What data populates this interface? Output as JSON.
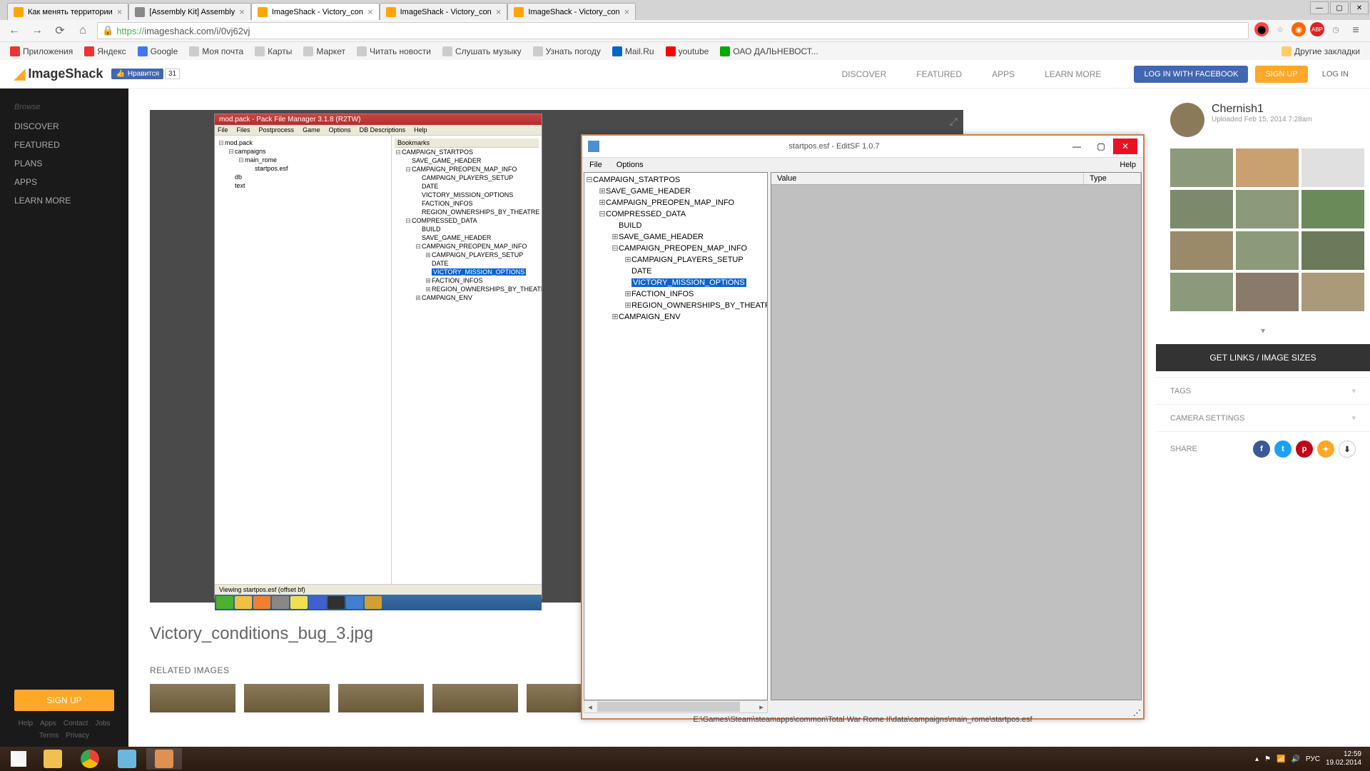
{
  "browser": {
    "tabs": [
      {
        "label": "Как менять территории",
        "active": false
      },
      {
        "label": "[Assembly Kit] Assembly",
        "active": false
      },
      {
        "label": "ImageShack - Victory_con",
        "active": true
      },
      {
        "label": "ImageShack - Victory_con",
        "active": false
      },
      {
        "label": "ImageShack - Victory_con",
        "active": false
      }
    ],
    "url_prefix": "https://",
    "url": "imageshack.com/i/0vj62vj",
    "bookmarks": [
      "Приложения",
      "Яндекс",
      "Google",
      "Моя почта",
      "Карты",
      "Маркет",
      "Читать новости",
      "Слушать музыку",
      "Узнать погоду",
      "Mail.Ru",
      "youtube",
      "ОАО ДАЛЬНЕВОСТ..."
    ],
    "other_bookmarks": "Другие закладки"
  },
  "imageshack": {
    "logo": "ImageShack",
    "fb_like": "Нравится",
    "fb_count": "31",
    "nav": [
      "DISCOVER",
      "FEATURED",
      "APPS",
      "LEARN MORE"
    ],
    "btn_fb": "LOG IN WITH FACEBOOK",
    "btn_signup": "SIGN UP",
    "btn_login": "LOG IN",
    "sidebar": {
      "heading": "Browse",
      "items": [
        "DISCOVER",
        "FEATURED",
        "PLANS",
        "APPS",
        "LEARN MORE"
      ],
      "signup": "SIGN UP",
      "footer": [
        "Help",
        "Apps",
        "Contact",
        "Jobs",
        "Terms",
        "Privacy"
      ]
    },
    "image_title": "Victory_conditions_bug_3.jpg",
    "related_title": "RELATED IMAGES",
    "right": {
      "user": "Chernish1",
      "uploaded": "Uploaded Feb 15, 2014 7:28am",
      "links_btn": "GET LINKS / IMAGE SIZES",
      "tags": "TAGS",
      "camera": "CAMERA SETTINGS",
      "share": "SHARE"
    }
  },
  "pfm": {
    "title": "mod.pack - Pack File Manager 3.1.8 (R2TW)",
    "menu": [
      "File",
      "Files",
      "Postprocess",
      "Game",
      "Options",
      "DB Descriptions",
      "Help"
    ],
    "bookmarks_label": "Bookmarks",
    "status": "Viewing startpos.esf (offset bf)",
    "left_tree": {
      "root": "mod.pack",
      "children": [
        {
          "l": "campaigns",
          "c": [
            {
              "l": "main_rome",
              "c": [
                {
                  "l": "startpos.esf"
                }
              ]
            }
          ]
        },
        {
          "l": "db"
        },
        {
          "l": "text"
        }
      ]
    },
    "right_tree": [
      {
        "l": "CAMPAIGN_STARTPOS",
        "e": "-",
        "c": [
          {
            "l": "SAVE_GAME_HEADER"
          },
          {
            "l": "CAMPAIGN_PREOPEN_MAP_INFO",
            "e": "-",
            "c": [
              {
                "l": "CAMPAIGN_PLAYERS_SETUP"
              },
              {
                "l": "DATE"
              },
              {
                "l": "VICTORY_MISSION_OPTIONS"
              },
              {
                "l": "FACTION_INFOS"
              },
              {
                "l": "REGION_OWNERSHIPS_BY_THEATRE"
              }
            ]
          },
          {
            "l": "COMPRESSED_DATA",
            "e": "-",
            "c": [
              {
                "l": "BUILD"
              },
              {
                "l": "SAVE_GAME_HEADER"
              },
              {
                "l": "CAMPAIGN_PREOPEN_MAP_INFO",
                "e": "-",
                "c": [
                  {
                    "l": "CAMPAIGN_PLAYERS_SETUP",
                    "e": "+"
                  },
                  {
                    "l": "DATE"
                  },
                  {
                    "l": "VICTORY_MISSION_OPTIONS",
                    "sel": true
                  },
                  {
                    "l": "FACTION_INFOS",
                    "e": "+"
                  },
                  {
                    "l": "REGION_OWNERSHIPS_BY_THEATRE",
                    "e": "+"
                  }
                ]
              },
              {
                "l": "CAMPAIGN_ENV",
                "e": "+"
              }
            ]
          }
        ]
      }
    ]
  },
  "editsf": {
    "title": "startpos.esf - EditSF 1.0.7",
    "menu_left": [
      "File",
      "Options"
    ],
    "menu_right": "Help",
    "grid_cols": [
      "Value",
      "Type"
    ],
    "status": "E:\\Games\\Steam\\steamapps\\common\\Total War Rome II\\data\\campaigns\\main_rome\\startpos.esf",
    "tree": [
      {
        "l": "CAMPAIGN_STARTPOS",
        "e": "-",
        "c": [
          {
            "l": "SAVE_GAME_HEADER",
            "e": "+"
          },
          {
            "l": "CAMPAIGN_PREOPEN_MAP_INFO",
            "e": "+"
          },
          {
            "l": "COMPRESSED_DATA",
            "e": "-",
            "c": [
              {
                "l": "BUILD"
              },
              {
                "l": "SAVE_GAME_HEADER",
                "e": "+"
              },
              {
                "l": "CAMPAIGN_PREOPEN_MAP_INFO",
                "e": "-",
                "c": [
                  {
                    "l": "CAMPAIGN_PLAYERS_SETUP",
                    "e": "+"
                  },
                  {
                    "l": "DATE"
                  },
                  {
                    "l": "VICTORY_MISSION_OPTIONS",
                    "sel": true
                  },
                  {
                    "l": "FACTION_INFOS",
                    "e": "+"
                  },
                  {
                    "l": "REGION_OWNERSHIPS_BY_THEATRE",
                    "e": "+"
                  }
                ]
              },
              {
                "l": "CAMPAIGN_ENV",
                "e": "+"
              }
            ]
          }
        ]
      }
    ]
  },
  "taskbar": {
    "lang": "РУС",
    "time": "12:59",
    "date": "19.02.2014"
  }
}
